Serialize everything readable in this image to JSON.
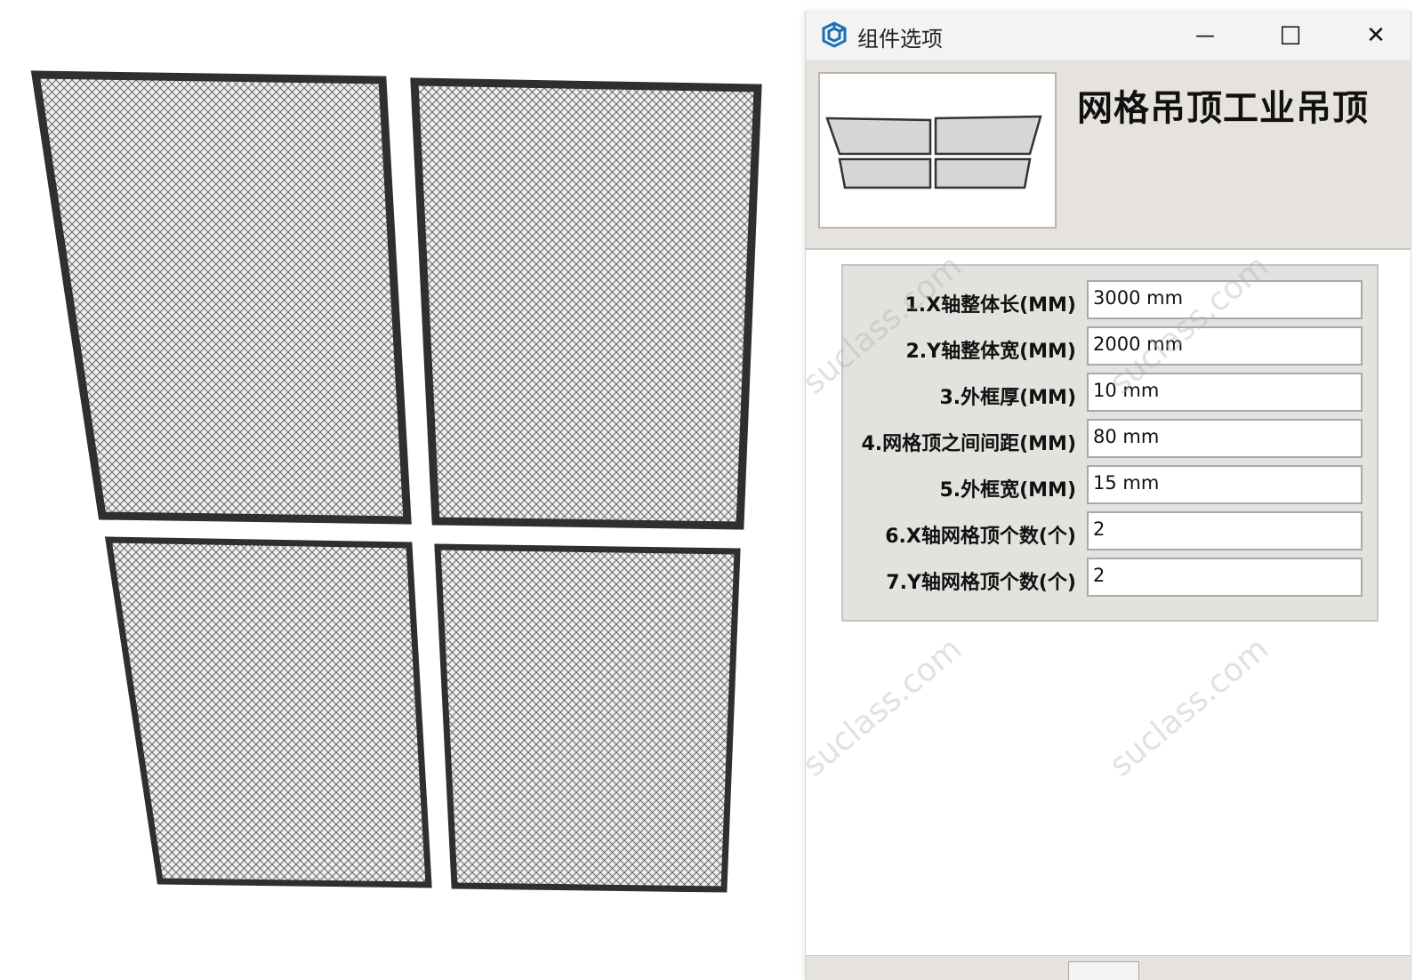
{
  "window": {
    "title": "组件选项",
    "minimize_glyph": "—",
    "maximize_glyph": "☐",
    "close_glyph": "✕"
  },
  "component": {
    "name": "网格吊顶工业吊顶"
  },
  "parameters": [
    {
      "label": "1.X轴整体长(MM)",
      "value": "3000 mm"
    },
    {
      "label": "2.Y轴整体宽(MM)",
      "value": "2000 mm"
    },
    {
      "label": "3.外框厚(MM)",
      "value": "10 mm"
    },
    {
      "label": "4.网格顶之间间距(MM)",
      "value": "80 mm"
    },
    {
      "label": "5.外框宽(MM)",
      "value": "15 mm"
    },
    {
      "label": "6.X轴网格顶个数(个)",
      "value": "2"
    },
    {
      "label": "7.Y轴网格顶个数(个)",
      "value": "2"
    }
  ],
  "watermark_text": "suclass.com",
  "colors": {
    "frame": "#2f2f2f",
    "mesh": "#555555",
    "app_icon": "#1a6fb5"
  },
  "icons": {
    "app": "sketchup-icon"
  }
}
